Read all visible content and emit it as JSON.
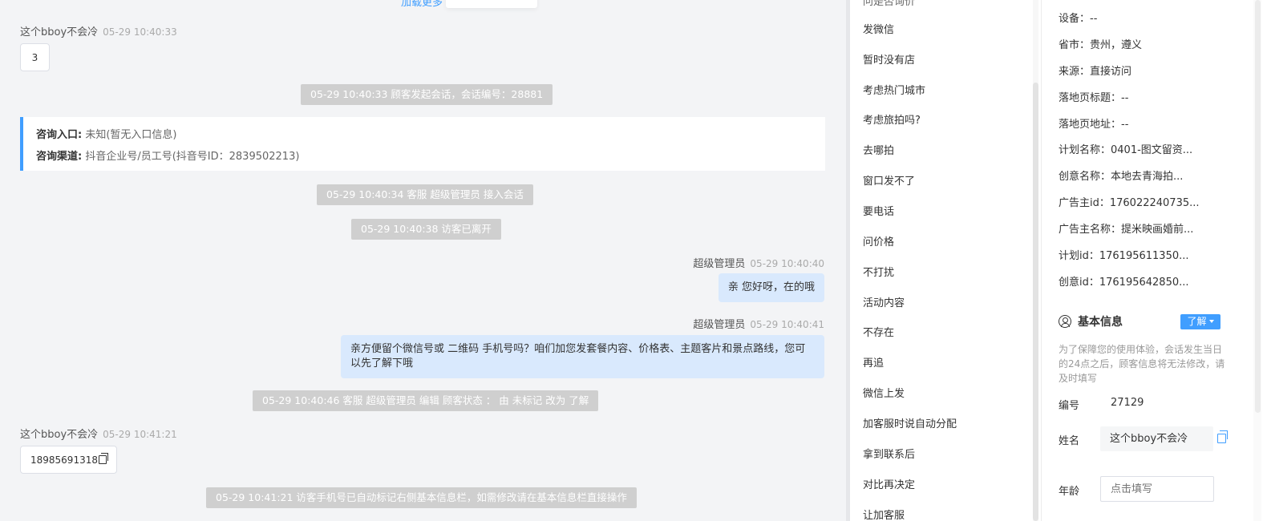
{
  "chat": {
    "load_more": "加载更多",
    "messages": [
      {
        "sender": "这个bboy不会冷",
        "time": "05-29 10:40:33",
        "text": "3"
      },
      {
        "system": "05-29 10:40:33 顾客发起会话，会话编号：28881"
      },
      {
        "system": "05-29 10:40:34 客服 超级管理员 接入会话"
      },
      {
        "system": "05-29 10:40:38 访客已离开"
      },
      {
        "sender": "超级管理员",
        "time": "05-29 10:40:40",
        "text": "亲 您好呀，在的哦"
      },
      {
        "sender": "超级管理员",
        "time": "05-29 10:40:41",
        "text": "亲方便留个微信号或 二维码 手机号吗？咱们加您发套餐内容、价格表、主题客片和景点路线，您可以先了解下哦"
      },
      {
        "system": "05-29 10:40:46 客服 超级管理员 编辑 顾客状态 ： 由 未标记 改为 了解"
      },
      {
        "sender": "这个bboy不会冷",
        "time": "05-29 10:41:21",
        "text": "18985691318"
      },
      {
        "system": "05-29 10:41:21 访客手机号已自动标记右侧基本信息栏，如需修改请在基本信息栏直接操作"
      }
    ],
    "entry": {
      "label1": "咨询入口:",
      "value1": "未知(暂无入口信息)",
      "label2": "咨询渠道:",
      "value2": "抖音企业号/员工号(抖音号ID：2839502213)"
    }
  },
  "quick_replies": [
    "发微信",
    "暂时没有店",
    "考虑热门城市",
    "考虑旅拍吗?",
    "去哪拍",
    "窗口发不了",
    "要电话",
    "问价格",
    "不打扰",
    "活动内容",
    "不存在",
    "再追",
    "微信上发",
    "加客服时说自动分配",
    "拿到联系后",
    "对比再决定",
    "让加客服"
  ],
  "info": {
    "rows": [
      "设备：--",
      "省市：贵州，遵义",
      "来源：直接访问",
      "落地页标题：--",
      "落地页地址：--",
      "计划名称：0401-图文留资...",
      "创意名称：本地去青海拍...",
      "广告主id：176022240735...",
      "广告主名称：提米映画婚前...",
      "计划id：176195611350...",
      "创意id：176195642850..."
    ],
    "basic_title": "基本信息",
    "tag": "了解",
    "notice": "为了保障您的使用体验，会话发生当日的24点之后，顾客信息将无法修改，请及时填写",
    "id_label": "编号",
    "id_value": "27129",
    "name_label": "姓名",
    "name_value": "这个bboy不会冷",
    "age_label": "年龄",
    "age_placeholder": "点击填写"
  }
}
